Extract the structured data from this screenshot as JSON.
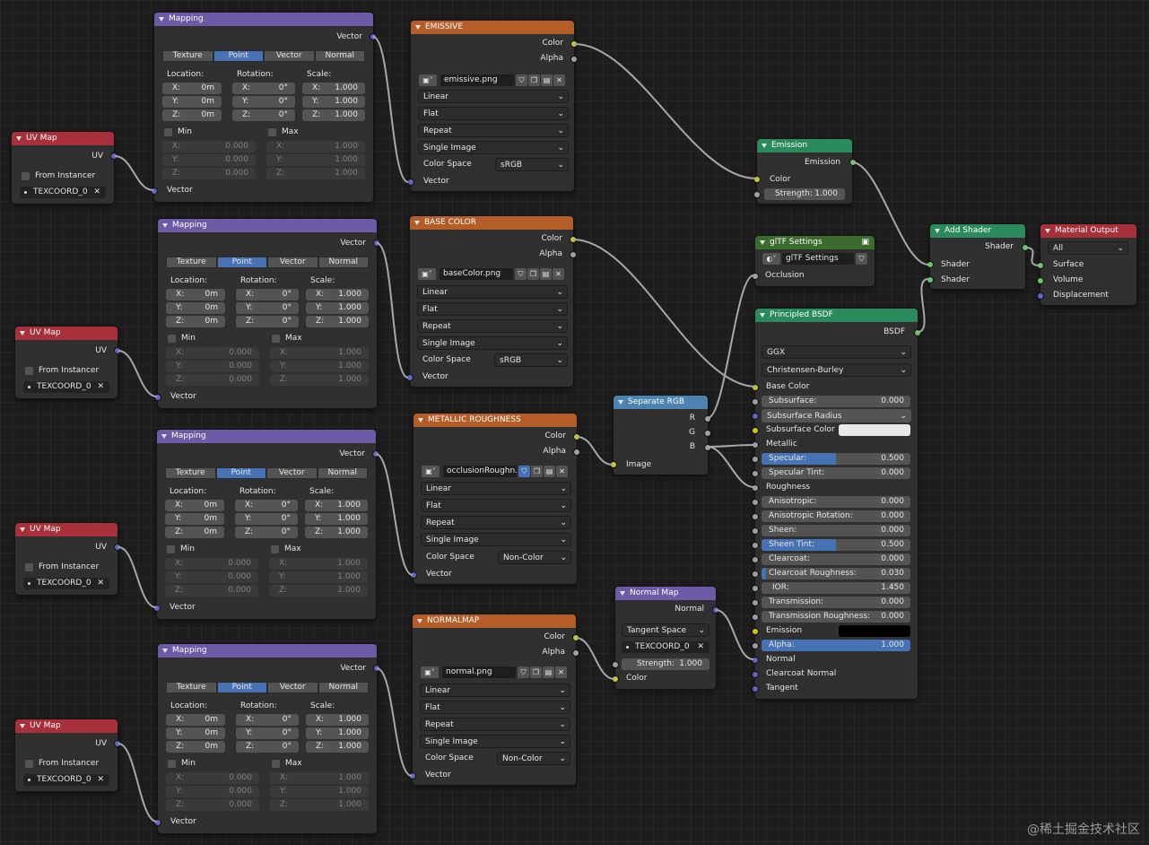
{
  "mapping": {
    "title": "Mapping",
    "out": "Vector",
    "tabs": [
      "Texture",
      "Point",
      "Vector",
      "Normal"
    ],
    "active_tab": "Point",
    "location": "Location:",
    "rotation": "Rotation:",
    "scale": "Scale:",
    "axes": [
      "X:",
      "Y:",
      "Z:"
    ],
    "loc": [
      "0m",
      "0m",
      "0m"
    ],
    "rot": [
      "0°",
      "0°",
      "0°"
    ],
    "scl": [
      "1.000",
      "1.000",
      "1.000"
    ],
    "min": "Min",
    "max": "Max",
    "min_vals": [
      "0.000",
      "0.000",
      "0.000"
    ],
    "max_vals": [
      "1.000",
      "1.000",
      "1.000"
    ],
    "in": "Vector"
  },
  "uvmap": {
    "title": "UV Map",
    "out": "UV",
    "from_instancer": "From Instancer",
    "attr": "TEXCOORD_0"
  },
  "image_nodes": [
    {
      "title": "EMISSIVE",
      "file": "emissive.png",
      "interp": "Linear",
      "proj": "Flat",
      "ext": "Repeat",
      "source": "Single Image",
      "cs_label": "Color Space",
      "cs": "sRGB"
    },
    {
      "title": "BASE COLOR",
      "file": "baseColor.png",
      "interp": "Linear",
      "proj": "Flat",
      "ext": "Repeat",
      "source": "Single Image",
      "cs_label": "Color Space",
      "cs": "sRGB"
    },
    {
      "title": "METALLIC ROUGHNESS",
      "file": "occlusionRoughn..",
      "interp": "Linear",
      "proj": "Flat",
      "ext": "Repeat",
      "source": "Single Image",
      "cs_label": "Color Space",
      "cs": "Non-Color"
    },
    {
      "title": "NORMALMAP",
      "file": "normal.png",
      "interp": "Linear",
      "proj": "Flat",
      "ext": "Repeat",
      "source": "Single Image",
      "cs_label": "Color Space",
      "cs": "Non-Color"
    }
  ],
  "image_sockets": {
    "color": "Color",
    "alpha": "Alpha",
    "vector": "Vector"
  },
  "emission": {
    "title": "Emission",
    "out": "Emission",
    "color": "Color",
    "strength": "Strength:",
    "strength_val": "1.000"
  },
  "gltf": {
    "title": "glTF Settings",
    "group": "glTF Settings",
    "occlusion": "Occlusion"
  },
  "add_shader": {
    "title": "Add Shader",
    "out": "Shader",
    "in1": "Shader",
    "in2": "Shader"
  },
  "output": {
    "title": "Material Output",
    "target": "All",
    "surface": "Surface",
    "volume": "Volume",
    "displacement": "Displacement"
  },
  "separate": {
    "title": "Separate RGB",
    "r": "R",
    "g": "G",
    "b": "B",
    "image": "Image"
  },
  "normal_map": {
    "title": "Normal Map",
    "out": "Normal",
    "space": "Tangent Space",
    "uv": "TEXCOORD_0",
    "strength": "Strength:",
    "strength_val": "1.000",
    "color": "Color"
  },
  "bsdf": {
    "title": "Principled BSDF",
    "out": "BSDF",
    "distribution": "GGX",
    "subsurface_method": "Christensen-Burley",
    "base_color": "Base Color",
    "subsurface": {
      "label": "Subsurface:",
      "value": "0.000"
    },
    "subsurface_radius": "Subsurface Radius",
    "subsurface_color": "Subsurface Color",
    "metallic": "Metallic",
    "specular": {
      "label": "Specular:",
      "value": "0.500",
      "fill": 0.5
    },
    "specular_tint": {
      "label": "Specular Tint:",
      "value": "0.000"
    },
    "roughness": "Roughness",
    "anisotropic": {
      "label": "Anisotropic:",
      "value": "0.000"
    },
    "anisotropic_rotation": {
      "label": "Anisotropic Rotation:",
      "value": "0.000"
    },
    "sheen": {
      "label": "Sheen:",
      "value": "0.000"
    },
    "sheen_tint": {
      "label": "Sheen Tint:",
      "value": "0.500",
      "fill": 0.5
    },
    "clearcoat": {
      "label": "Clearcoat:",
      "value": "0.000"
    },
    "clearcoat_roughness": {
      "label": "Clearcoat Roughness:",
      "value": "0.030",
      "fill": 0.03
    },
    "ior": {
      "label": "IOR:",
      "value": "1.450"
    },
    "transmission": {
      "label": "Transmission:",
      "value": "0.000"
    },
    "transmission_roughness": {
      "label": "Transmission Roughness:",
      "value": "0.000"
    },
    "emission": "Emission",
    "alpha": {
      "label": "Alpha:",
      "value": "1.000",
      "fill": 1.0
    },
    "normal": "Normal",
    "clearcoat_normal": "Clearcoat Normal",
    "tangent": "Tangent"
  },
  "watermark": "@稀土掘金技术社区"
}
